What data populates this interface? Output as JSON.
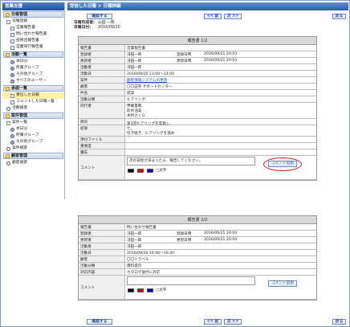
{
  "sidebar": {
    "app_title": "営業支援",
    "sections": [
      {
        "label": "日報管理",
        "items": [
          {
            "label": "日報登録",
            "level": 1
          },
          {
            "label": "営業報告書",
            "level": 2
          },
          {
            "label": "問い合わせ報告書",
            "level": 2
          },
          {
            "label": "技術出報告書",
            "level": 2
          },
          {
            "label": "営業同行報告書",
            "level": 2
          }
        ]
      },
      {
        "label": "活動一覧",
        "items": [
          {
            "label": "本日分",
            "level": 2
          },
          {
            "label": "所属グループ",
            "level": 2
          },
          {
            "label": "その他グループ",
            "level": 2
          },
          {
            "label": "すべてのユーザー",
            "level": 2
          }
        ]
      },
      {
        "label": "承認一覧",
        "items": [
          {
            "label": "受信した日報",
            "level": 2,
            "active": true
          },
          {
            "label": "コメントした日報一覧",
            "level": 2
          },
          {
            "label": "活動検索",
            "level": 1
          }
        ]
      },
      {
        "label": "案件管理",
        "items": [
          {
            "label": "案件一覧",
            "level": 1
          },
          {
            "label": "本日分",
            "level": 2
          },
          {
            "label": "所属グループ",
            "level": 2
          },
          {
            "label": "その他グループ",
            "level": 2
          },
          {
            "label": "案件検索",
            "level": 1
          }
        ]
      },
      {
        "label": "顧客管理",
        "items": [
          {
            "label": "顧客検索",
            "level": 1
          }
        ]
      }
    ]
  },
  "header": {
    "breadcrumb": "受信した日報 > 日報詳細"
  },
  "toolbar": {
    "confirm": "確認する",
    "prev": "<< 前",
    "next": "次 >>",
    "back": "戻る"
  },
  "meta": {
    "author_label": "日報作成者:",
    "author": "山田 一郎",
    "date_label": "日報日付:",
    "date": "2016/09/20"
  },
  "report1": {
    "header": "報告書 1/2",
    "rows": [
      {
        "label": "報告書",
        "value": "営業報告書"
      },
      {
        "label": "登録者",
        "value": "冴田一郎",
        "k2": "登録日時",
        "v2": "2016/09/21 20:03"
      },
      {
        "label": "更新者",
        "value": "冴田一郎",
        "k2": "更新日時",
        "v2": "2016/09/21 20:03"
      },
      {
        "label": "活動者",
        "value": "冴田一郎"
      },
      {
        "label": "活動日",
        "value": "2016/09/20 13:00～14:00"
      },
      {
        "label": "案件",
        "value": "顧客情報システムの更改",
        "link": true
      },
      {
        "label": "顧客",
        "value": "〇〇証券 サポートセンター"
      },
      {
        "label": "件名",
        "value": "提案"
      },
      {
        "label": "活動分類",
        "value": "ヒアリング"
      },
      {
        "label": "同行者",
        "value": "伊藤量哉\n鈴木浩美\n木村さくら"
      },
      {
        "label": "目的",
        "value": ""
      },
      {
        "label": "結果",
        "value": "第1回ヒアリングを実施した。\n引き続き、ヒアリングを進める。"
      },
      {
        "label": "添付ファイル",
        "value": ""
      },
      {
        "label": "重要度",
        "value": ""
      },
      {
        "label": "優先",
        "value": ""
      }
    ],
    "comment_label": "コメント",
    "comment_text": "次の日程が決まったら、報告してください。",
    "comment_button": "コメント追加",
    "colors": [
      "■",
      "■",
      "■",
      "□太字"
    ]
  },
  "report2": {
    "header": "報告書 2/2",
    "rows": [
      {
        "label": "報告書",
        "value": "問い合わせ報告書"
      },
      {
        "label": "登録者",
        "value": "冴田一郎",
        "k2": "登録日時",
        "v2": "2016/09/21 20:04"
      },
      {
        "label": "更新者",
        "value": "冴田一郎",
        "k2": "更新日時",
        "v2": "2016/09/21 20:04"
      },
      {
        "label": "活動者",
        "value": "冴田一郎"
      },
      {
        "label": "活動日",
        "value": "2016/09/20 16:00～16:30"
      },
      {
        "label": "顧客",
        "value": "〇〇トラベル"
      },
      {
        "label": "活動分類",
        "value": "資料提示"
      },
      {
        "label": "対応内容",
        "value": "カタログ送付に対応"
      }
    ],
    "comment_label": "コメント",
    "comment_button": "コメント追加",
    "colors": [
      "■",
      "■",
      "■",
      "□太字"
    ]
  },
  "colors": {
    "accent": "#2a5fae",
    "highlight_oval": "#d62020"
  }
}
